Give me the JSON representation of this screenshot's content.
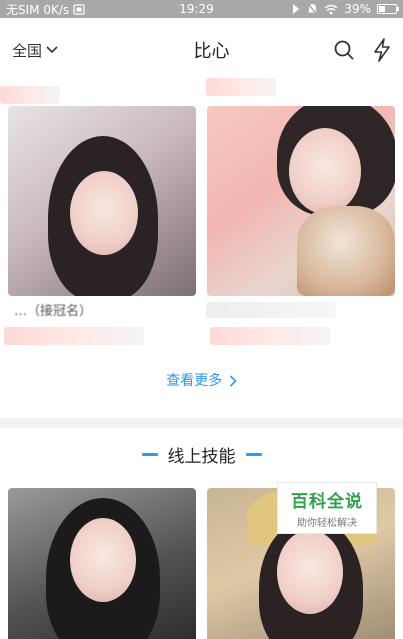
{
  "status_bar": {
    "carrier": "无SIM 0K/s",
    "time": "19:29",
    "battery_text": "39%",
    "battery_level": 0.39
  },
  "header": {
    "region": "全国",
    "title": "比心"
  },
  "section_featured": {
    "cards": [
      {
        "caption": "…（接冠名）"
      },
      {
        "caption": ""
      }
    ],
    "more_link": "查看更多"
  },
  "section_online": {
    "title": "线上技能"
  },
  "watermark": {
    "title": "百科全说",
    "subtitle": "助你轻松解决"
  },
  "colors": {
    "accent": "#2e9ae8",
    "watermark_green": "#2fa24a"
  }
}
